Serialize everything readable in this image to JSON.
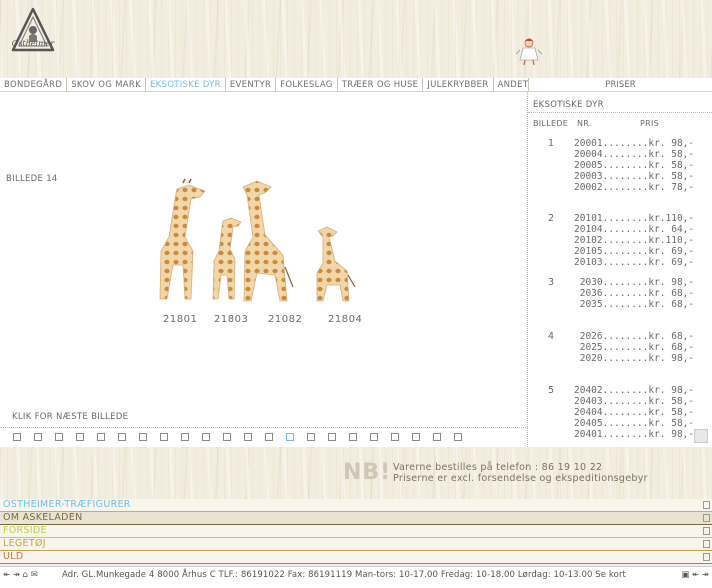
{
  "header": {
    "logo_text": "Ostheimer",
    "mascot_icon": "child-figure-icon"
  },
  "nav": {
    "items": [
      {
        "label": "BONDEGÅRD"
      },
      {
        "label": "SKOV OG MARK"
      },
      {
        "label": "EKSOTISKE DYR",
        "active": true
      },
      {
        "label": "EVENTYR"
      },
      {
        "label": "FOLKESLAG"
      },
      {
        "label": "TRÆER OG HUSE"
      },
      {
        "label": "JULEKRYBBER"
      },
      {
        "label": "ANDET"
      }
    ],
    "priser_label": "PRISER"
  },
  "main": {
    "billede_label": "BILLEDE 14",
    "art_numbers": [
      "21801",
      "21803",
      "21082",
      "21804"
    ],
    "klik_label": "KLIK FOR NÆSTE BILLEDE",
    "thumb_count": 22,
    "active_thumb": 13
  },
  "side": {
    "title": "EKSOTISKE DYR",
    "col_billede": "BILLEDE",
    "col_nr": "NR.",
    "col_pris": "PRIS",
    "groups": [
      {
        "num": "1",
        "lines": [
          "20001........kr. 98,-",
          "20004........kr. 58,-",
          "20005........kr. 58,-",
          "20003........kr. 58,-",
          "20002........kr. 78,-"
        ]
      },
      {
        "num": "2",
        "lines": [
          "20101........kr.110,-",
          "20104........kr. 64,-",
          "20102........kr.110,-",
          "20105........kr. 69,-",
          "20103........kr. 69,-"
        ]
      },
      {
        "num": "3",
        "lines": [
          " 2030........kr. 98,-",
          " 2036........kr. 68,-",
          " 2035........kr. 68,-"
        ]
      },
      {
        "num": "4",
        "lines": [
          " 2026........kr. 68,-",
          " 2025........kr. 68,-",
          " 2020........kr. 98,-"
        ]
      },
      {
        "num": "5",
        "lines": [
          "20402........kr. 98,-",
          "20403........kr. 58,-",
          "20404........kr. 58,-",
          "20405........kr. 58,-",
          "20401........kr. 98,-"
        ]
      }
    ]
  },
  "nb": {
    "mark": "NB!",
    "line1": "Varerne bestilles på telefon : 86 19 10 22",
    "line2": "Priserne er excl. forsendelse og ekspeditionsgebyr"
  },
  "footer_links": [
    {
      "label": "OSTHEIMER-TRÆFIGURER",
      "color": "#6ec0e4"
    },
    {
      "label": "OM ASKELADEN",
      "color": "#7a6a3a"
    },
    {
      "label": "FORSIDE",
      "color": "#b9d23c"
    },
    {
      "label": "LEGETØJ",
      "color": "#c8a040"
    },
    {
      "label": "ULD",
      "color": "#c87a3a"
    }
  ],
  "bottom_bar": {
    "text": "Adr. GL.Munkegade 4   8000 Århus C   TLF.: 86191022   Fax: 86191119   Man-tors: 10-17.00   Fredag: 10-18.00   Lørdag: 10-13.00  Se kort"
  }
}
